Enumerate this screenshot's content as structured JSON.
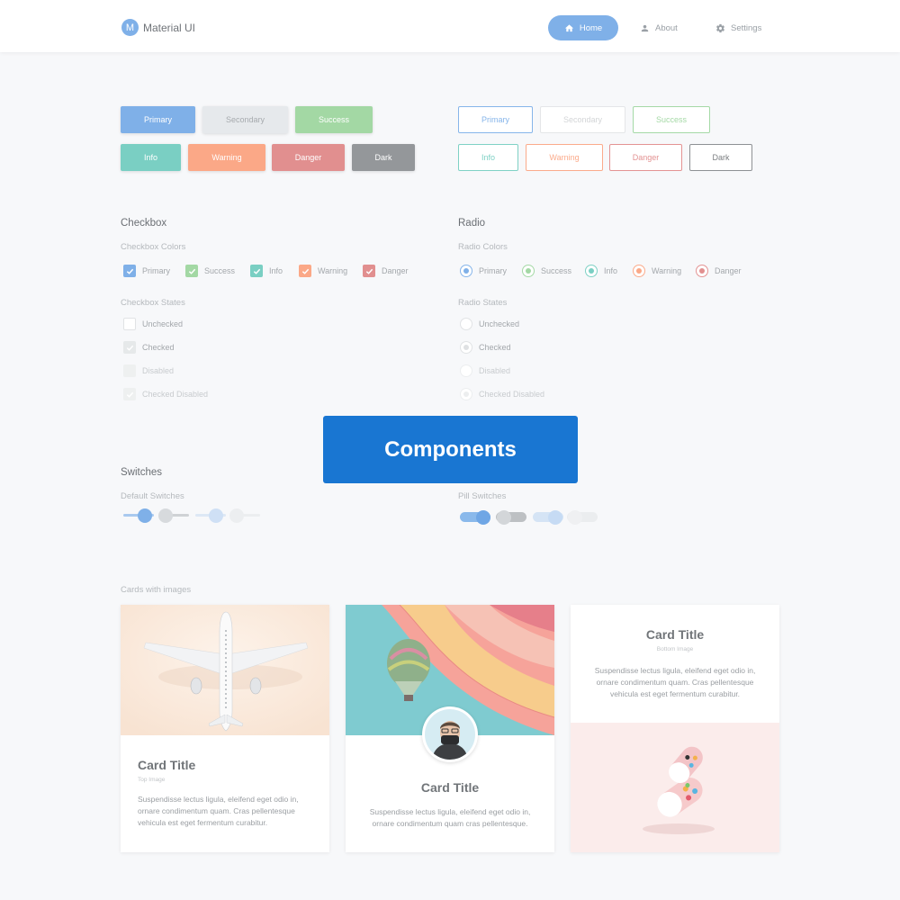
{
  "navbar": {
    "brand_letter": "M",
    "brand_name": "Material UI",
    "items": [
      {
        "label": "Home",
        "icon": "home-icon"
      },
      {
        "label": "About",
        "icon": "person-icon"
      },
      {
        "label": "Settings",
        "icon": "gear-icon"
      }
    ]
  },
  "buttons": {
    "solid": [
      "Primary",
      "Secondary",
      "Success",
      "Info",
      "Warning",
      "Danger",
      "Dark"
    ],
    "outline": [
      "Primary",
      "Secondary",
      "Success",
      "Info",
      "Warning",
      "Danger",
      "Dark"
    ]
  },
  "colors": {
    "primary": "#7fb0e8",
    "secondary": "#e6e9ec",
    "success": "#a3d8a4",
    "info": "#7acfc3",
    "warning": "#fba887",
    "danger": "#e18f8f",
    "dark": "#94979a"
  },
  "checkbox": {
    "title": "Checkbox",
    "colors_label": "Checkbox Colors",
    "colors": [
      "Primary",
      "Success",
      "Info",
      "Warning",
      "Danger"
    ],
    "states_label": "Checkbox States",
    "states": [
      "Unchecked",
      "Checked",
      "Disabled",
      "Checked Disabled"
    ]
  },
  "radio": {
    "title": "Radio",
    "colors_label": "Radio Colors",
    "colors": [
      "Primary",
      "Success",
      "Info",
      "Warning",
      "Danger"
    ],
    "states_label": "Radio States",
    "states": [
      "Unchecked",
      "Checked",
      "Disabled",
      "Checked Disabled"
    ]
  },
  "switches": {
    "title": "Switches",
    "default_label": "Default Switches",
    "pill_label": "Pill Switches"
  },
  "overlay": {
    "label": "Components"
  },
  "cards": {
    "section_label": "Cards with images",
    "items": [
      {
        "title": "Card Title",
        "subtitle": "Top Image",
        "text": "Suspendisse lectus ligula, eleifend eget odio in, ornare condimentum quam. Cras pellentesque vehicula est eget fermentum curabitur."
      },
      {
        "title": "Card Title",
        "text": "Suspendisse lectus ligula, eleifend eget odio in, ornare condimentum quam cras pellentesque."
      },
      {
        "title": "Card Title",
        "subtitle": "Bottom Image",
        "text": "Suspendisse lectus ligula, eleifend eget odio in, ornare condimentum quam. Cras pellentesque vehicula est eget fermentum curabitur."
      }
    ]
  }
}
